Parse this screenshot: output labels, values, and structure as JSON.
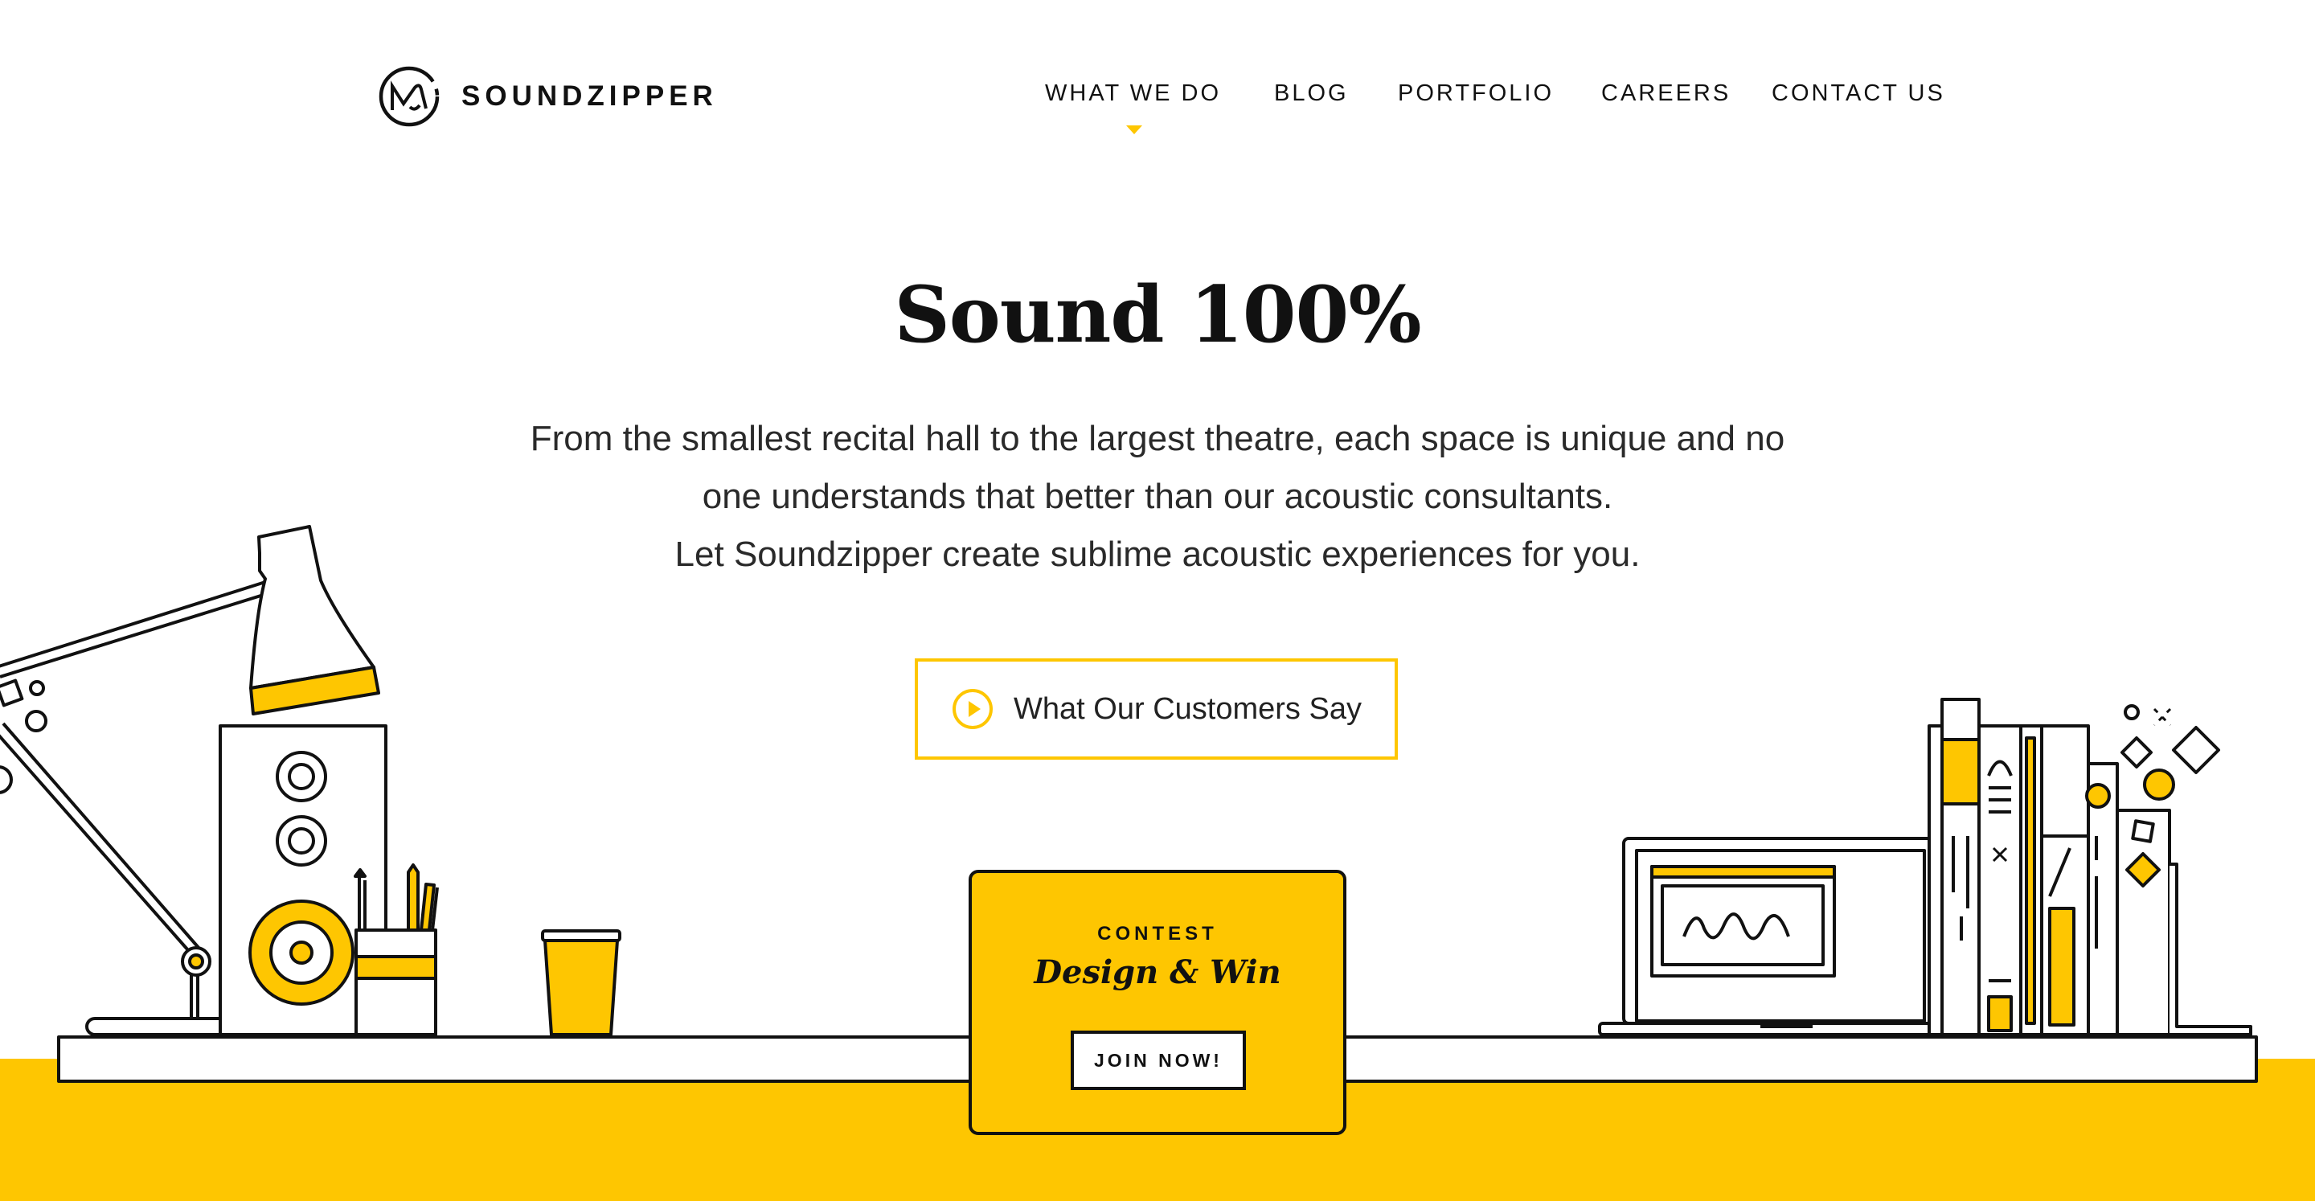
{
  "brand": {
    "name": "SOUNDZIPPER"
  },
  "nav": {
    "items": [
      {
        "label": "WHAT WE DO",
        "active": true
      },
      {
        "label": "BLOG",
        "active": false
      },
      {
        "label": "PORTFOLIO",
        "active": false
      },
      {
        "label": "CAREERS",
        "active": false
      },
      {
        "label": "CONTACT US",
        "active": false
      }
    ]
  },
  "hero": {
    "title": "Sound 100%",
    "lines": [
      "From the smallest recital hall to the largest theatre, each space is unique and no",
      "one understands that better than our acoustic consultants.",
      "Let Soundzipper create sublime acoustic experiences for you."
    ],
    "cta_label": "What Our Customers Say",
    "cta_icon": "play-circle-icon"
  },
  "contest": {
    "kicker": "CONTEST",
    "title": "Design & Win",
    "button_label": "JOIN NOW!"
  },
  "colors": {
    "accent": "#fec601",
    "ink": "#111111",
    "background": "#ffffff"
  }
}
